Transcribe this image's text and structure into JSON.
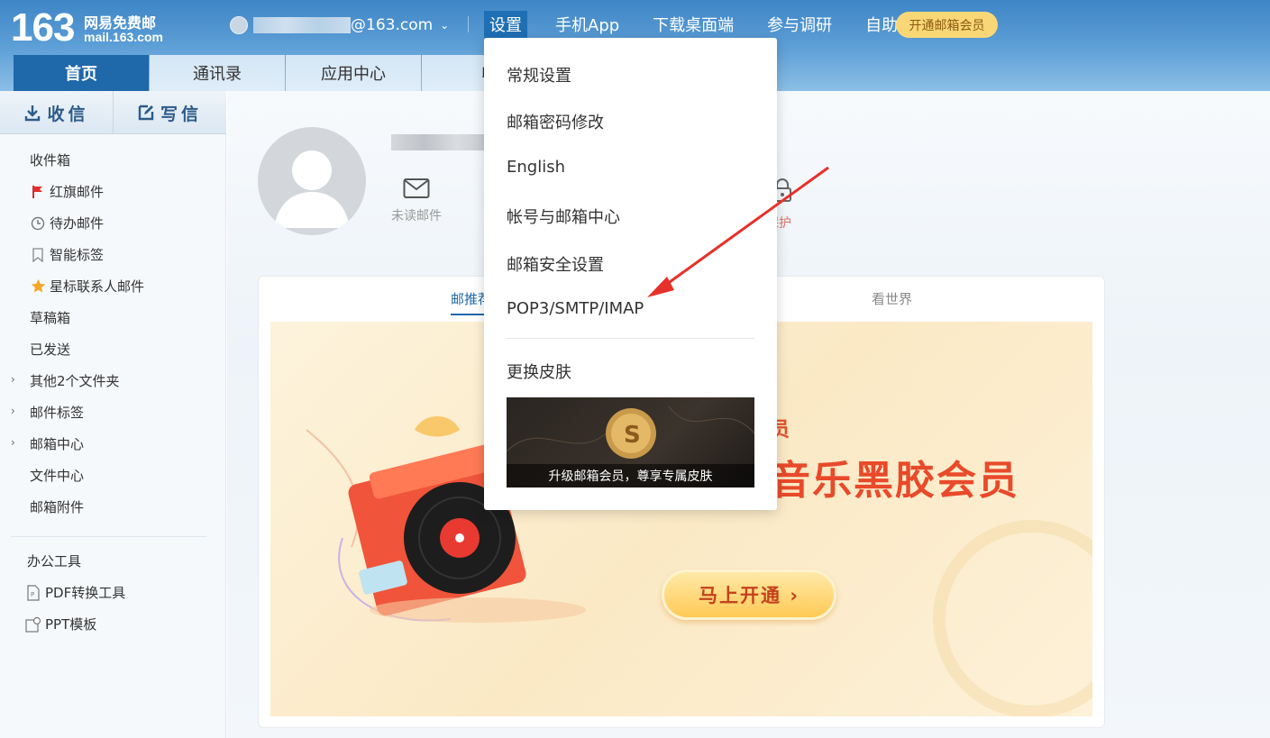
{
  "logo": {
    "number": "163",
    "name": "网易免费邮",
    "domain": "mail.163.com"
  },
  "account": {
    "email_suffix": "@163.com"
  },
  "top_nav": [
    "设置",
    "手机App",
    "下载桌面端",
    "参与调研",
    "自助查询"
  ],
  "vip_button": "开通邮箱会员",
  "tabs": [
    "首页",
    "通讯录",
    "应用中心",
    "收"
  ],
  "compose": {
    "receive": "收信",
    "write": "写信"
  },
  "folders": {
    "inbox": "收件箱",
    "red_flag": "红旗邮件",
    "todo": "待办邮件",
    "smart_tags": "智能标签",
    "star_contacts": "星标联系人邮件",
    "drafts": "草稿箱",
    "sent": "已发送",
    "other": "其他2个文件夹",
    "mail_tags": "邮件标签",
    "mail_center": "邮箱中心",
    "file_center": "文件中心",
    "attachments": "邮箱附件"
  },
  "tools": {
    "title": "办公工具",
    "pdf": "PDF转换工具",
    "ppt": "PPT模板"
  },
  "profile": {
    "unread_label": "未读邮件",
    "protect_label": "保护"
  },
  "card": {
    "tab_recommend": "邮推荐",
    "tab_world": "看世界",
    "banner_small": "员",
    "banner_title": "音乐黑胶会员",
    "banner_button": "马上开通 ›"
  },
  "dropdown": {
    "items": [
      "常规设置",
      "邮箱密码修改",
      "English",
      "帐号与邮箱中心",
      "邮箱安全设置",
      "POP3/SMTP/IMAP",
      "更换皮肤"
    ],
    "promo_caption": "升级邮箱会员，尊享专属皮肤"
  },
  "colors": {
    "header": "#3e86c6",
    "active_tab": "#1f68aa",
    "vip": "#f9d777",
    "arrow": "#e8302a"
  }
}
